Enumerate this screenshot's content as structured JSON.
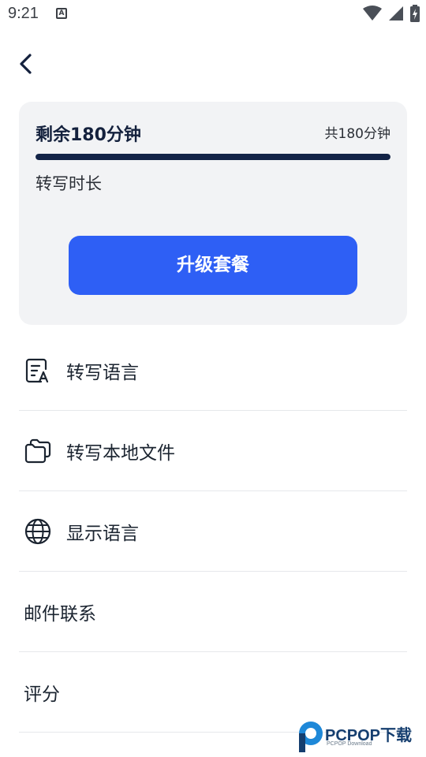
{
  "status_bar": {
    "time": "9:21",
    "app_icon_letter": "A"
  },
  "usage": {
    "remaining": "剩余180分钟",
    "total": "共180分钟",
    "label": "转写时长",
    "progress_fraction": 1.0,
    "upgrade_label": "升级套餐"
  },
  "menu": {
    "items": [
      {
        "label": "转写语言",
        "icon": "document-language-icon"
      },
      {
        "label": "转写本地文件",
        "icon": "folders-icon"
      },
      {
        "label": "显示语言",
        "icon": "globe-icon"
      },
      {
        "label": "邮件联系",
        "icon": ""
      },
      {
        "label": "评分",
        "icon": ""
      }
    ]
  },
  "watermark": {
    "text": "PCPOP下载",
    "sub": "PCPOP Download"
  },
  "colors": {
    "accent": "#2e5ff5",
    "progress": "#132447",
    "card_bg": "#f2f3f5"
  }
}
